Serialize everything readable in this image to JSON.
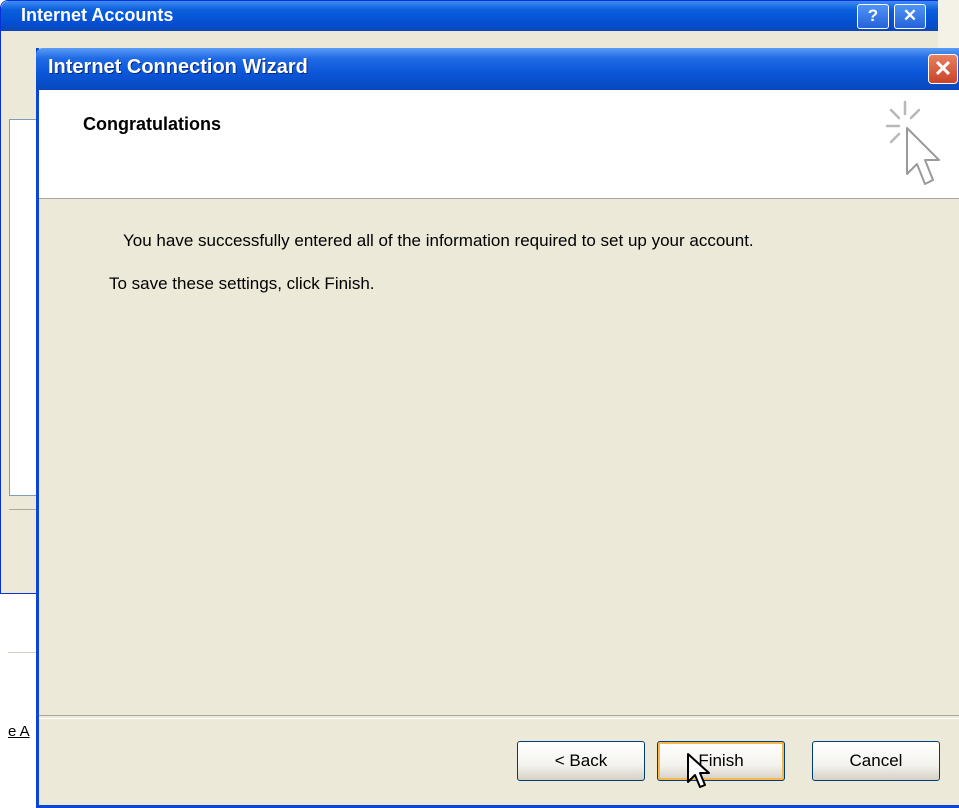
{
  "background_window": {
    "title": "Internet Accounts",
    "help_button": "?",
    "close_button": "✕",
    "link_fragment": "e A"
  },
  "wizard": {
    "title": "Internet Connection Wizard",
    "close_button": "✕",
    "header_title": "Congratulations",
    "header_icon": "wizard-cursor-icon",
    "body": {
      "line1": "You have successfully entered all of the information required to set up your account.",
      "line2": "To save these settings, click Finish."
    },
    "buttons": {
      "back": "< Back",
      "finish": "Finish",
      "cancel": "Cancel"
    }
  },
  "colors": {
    "titlebar_blue": "#0a56d8",
    "window_face": "#ece9d8",
    "close_red": "#c8432a",
    "default_button_highlight": "#f8b74a"
  }
}
